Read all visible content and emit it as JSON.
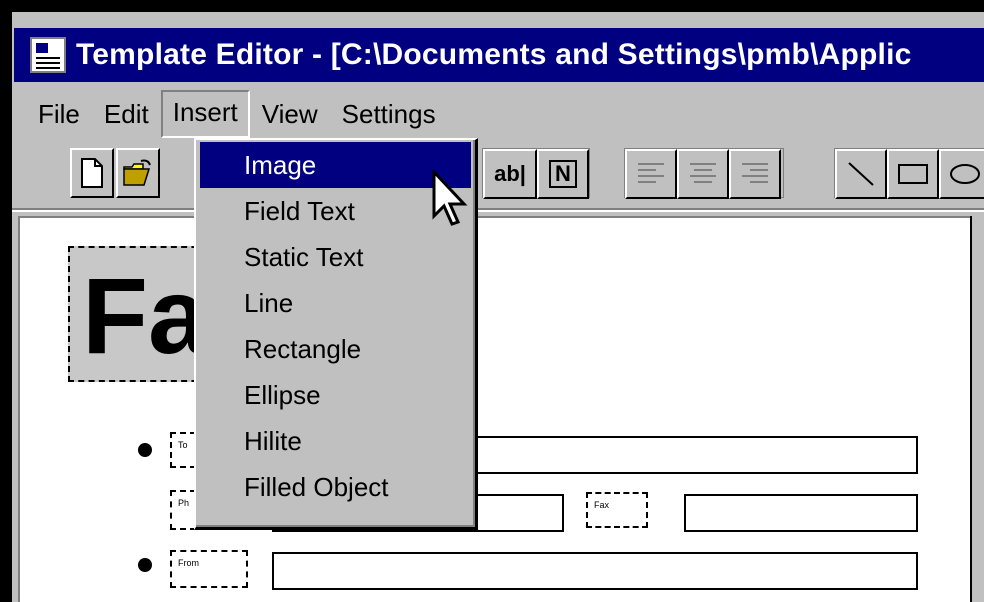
{
  "window": {
    "title": "Template Editor - [C:\\Documents and Settings\\pmb\\Applic"
  },
  "menubar": {
    "items": [
      {
        "label": "File"
      },
      {
        "label": "Edit"
      },
      {
        "label": "Insert"
      },
      {
        "label": "View"
      },
      {
        "label": "Settings"
      }
    ],
    "open_menu": "Insert"
  },
  "toolbar": {
    "buttons": [
      {
        "icon": "new-document-icon"
      },
      {
        "icon": "open-folder-icon"
      },
      {
        "label": "ab|"
      },
      {
        "label": "N"
      },
      {
        "icon": "align-left-icon"
      },
      {
        "icon": "align-center-icon"
      },
      {
        "icon": "align-right-icon"
      },
      {
        "icon": "line-icon"
      },
      {
        "icon": "rectangle-icon"
      },
      {
        "icon": "ellipse-icon"
      }
    ]
  },
  "insert_menu": {
    "items": [
      {
        "label": "Image",
        "selected": true
      },
      {
        "label": "Field Text"
      },
      {
        "label": "Static Text"
      },
      {
        "label": "Line"
      },
      {
        "label": "Rectangle"
      },
      {
        "label": "Ellipse"
      },
      {
        "label": "Hilite"
      },
      {
        "label": "Filled Object"
      }
    ]
  },
  "canvas": {
    "logo_text": "Fa",
    "fields": [
      {
        "label": "To"
      },
      {
        "label": "Ph"
      },
      {
        "label": "Fax"
      },
      {
        "label": "From"
      }
    ]
  },
  "colors": {
    "titlebar": "#000080",
    "chrome": "#c0c0c0",
    "selection": "#000080"
  }
}
